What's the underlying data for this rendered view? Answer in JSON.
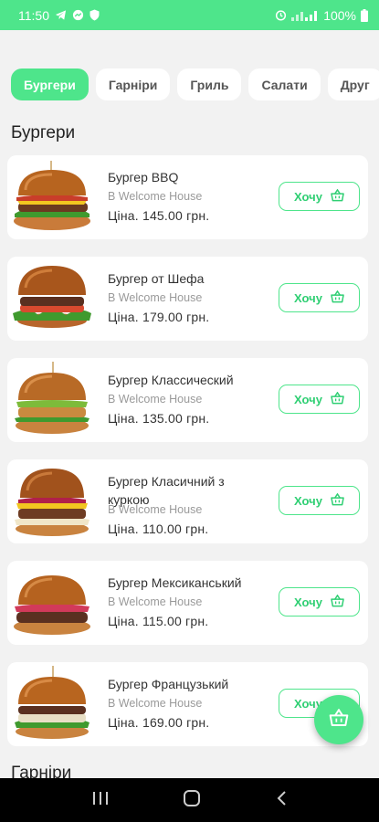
{
  "status_bar": {
    "time": "11:50",
    "battery": "100%"
  },
  "tabs": [
    {
      "label": "Бургери",
      "active": true
    },
    {
      "label": "Гарніри",
      "active": false
    },
    {
      "label": "Гриль",
      "active": false
    },
    {
      "label": "Салати",
      "active": false
    },
    {
      "label": "Друг",
      "active": false
    }
  ],
  "sections": {
    "burgers_title": "Бургери",
    "sides_title": "Гарніри"
  },
  "products": [
    {
      "name": "Бургер BBQ",
      "venue": "B Welcome House",
      "price": "Ціна. 145.00 грн.",
      "button": "Хочу"
    },
    {
      "name": "Бургер от Шефа",
      "venue": "B Welcome House",
      "price": "Ціна. 179.00 грн.",
      "button": "Хочу"
    },
    {
      "name": "Бургер Классический",
      "venue": "B Welcome House",
      "price": "Ціна. 135.00 грн.",
      "button": "Хочу"
    },
    {
      "name": "Бургер Класичний з куркою",
      "venue": "B Welcome House",
      "price": "Ціна. 110.00 грн.",
      "button": "Хочу"
    },
    {
      "name": "Бургер Мексиканський",
      "venue": "B Welcome House",
      "price": "Ціна. 115.00 грн.",
      "button": "Хочу"
    },
    {
      "name": "Бургер Французький",
      "venue": "B Welcome House",
      "price": "Ціна. 169.00 грн.",
      "button": "Хочу"
    }
  ],
  "colors": {
    "accent": "#4ee58b",
    "accent_text": "#2fcf73",
    "background": "#f2f2f2"
  },
  "icons": {
    "add_to_basket": "basket-icon",
    "cart_fab": "basket-icon"
  }
}
